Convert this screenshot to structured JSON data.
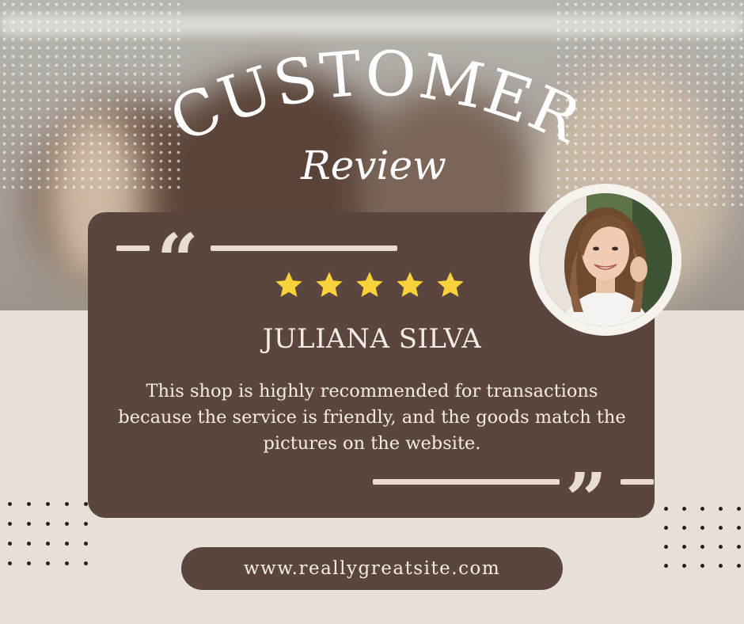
{
  "heading": {
    "title": "CUSTOMER",
    "script": "Review"
  },
  "review": {
    "rating": 5,
    "rating_max": 5,
    "name": "JULIANA SILVA",
    "text": "This shop is highly recommended for transactions because the service is friendly, and the goods match the pictures on the website."
  },
  "website": "www.reallygreatsite.com",
  "colors": {
    "card": "#5a463e",
    "background": "#e6e0d9",
    "star": "#f7d23a",
    "text": "#f4ece4"
  }
}
